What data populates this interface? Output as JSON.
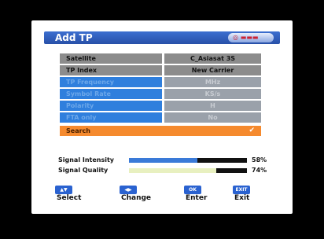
{
  "window": {
    "title": "Add TP"
  },
  "rows": [
    {
      "label": "Satellite",
      "value": "C_Asiasat 3S"
    },
    {
      "label": "TP Index",
      "value": "New Carrier"
    },
    {
      "label": "TP Frequency",
      "value": "MHz"
    },
    {
      "label": "Symbol Rate",
      "value": "KS/s"
    },
    {
      "label": "Polarity",
      "value": "H"
    },
    {
      "label": "FTA only",
      "value": "No"
    },
    {
      "label": "Search",
      "value": "✔"
    }
  ],
  "signal": {
    "intensity": {
      "label": "Signal Intensity",
      "percent": 58,
      "percent_text": "58%"
    },
    "quality": {
      "label": "Signal Quality",
      "percent": 74,
      "percent_text": "74%"
    }
  },
  "footer": {
    "select_label": "Select",
    "change_label": "Change",
    "enter_label": "Enter",
    "exit_label": "Exit"
  },
  "colors": {
    "title_bar": "#2850a8",
    "highlight": "#f58a2e",
    "intensity_fill": "#3a7ad8",
    "quality_fill": "#e8f0c0"
  }
}
